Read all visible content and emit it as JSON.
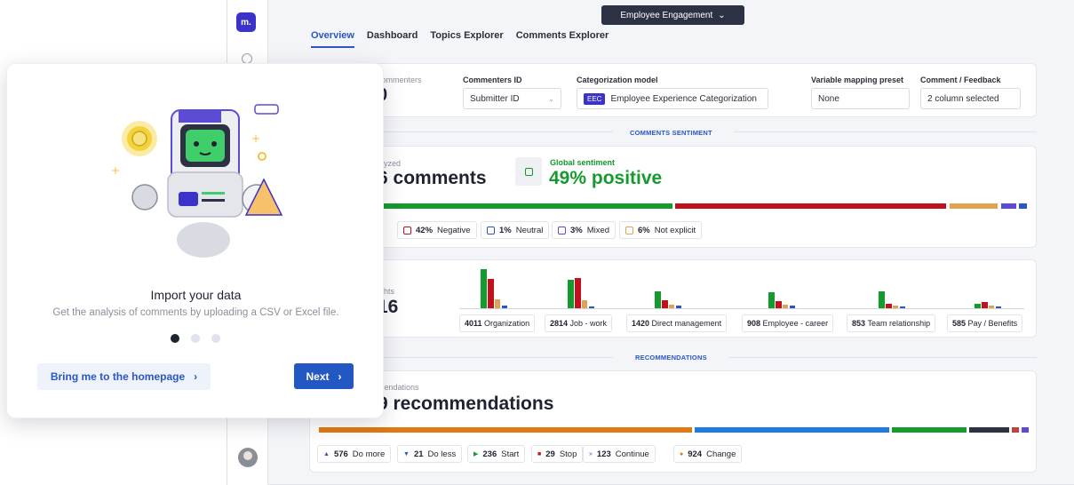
{
  "app": {
    "logo": "m.",
    "survey_selector": "Employee Engagement",
    "tabs": [
      "Overview",
      "Dashboard",
      "Topics Explorer",
      "Comments Explorer"
    ]
  },
  "config": {
    "commenters_label": "commenters",
    "commenters_value": "0",
    "commenters_id_label": "Commenters ID",
    "commenters_id_value": "Submitter ID",
    "categorization_label": "Categorization model",
    "categorization_badge": "EEC",
    "categorization_value": "Employee Experience Categorization",
    "variable_label": "Variable mapping preset",
    "variable_value": "None",
    "comment_label": "Comment / Feedback",
    "comment_value": "2 column selected"
  },
  "sentiment": {
    "section_title": "COMMENTS SENTIMENT",
    "analyzed_label": "alyzed",
    "analyzed_value": "6 comments",
    "global_label": "Global sentiment",
    "global_value": "49% positive",
    "colors": {
      "positive": "#159a2e",
      "negative": "#c2111c",
      "neutral": "#2a56c6",
      "mixed": "#5b4bd6",
      "not_explicit": "#e0a34f"
    },
    "chips": [
      {
        "value": "42%",
        "label": "Negative",
        "color": "#c2111c"
      },
      {
        "value": "1%",
        "label": "Neutral",
        "color": "#2a56c6"
      },
      {
        "value": "3%",
        "label": "Mixed",
        "color": "#5b4bd6"
      },
      {
        "value": "6%",
        "label": "Not explicit",
        "color": "#e0a34f"
      }
    ]
  },
  "insights": {
    "label": "ights",
    "value": "16",
    "categories": [
      {
        "count": "4011",
        "name": "Organization",
        "bars": [
          100,
          76,
          22,
          6
        ]
      },
      {
        "count": "2814",
        "name": "Job - work",
        "bars": [
          72,
          78,
          20,
          4
        ]
      },
      {
        "count": "1420",
        "name": "Direct management",
        "bars": [
          44,
          20,
          8,
          6
        ]
      },
      {
        "count": "908",
        "name": "Employee - career",
        "bars": [
          40,
          18,
          8,
          6
        ]
      },
      {
        "count": "853",
        "name": "Team relationship",
        "bars": [
          44,
          12,
          6,
          4
        ]
      },
      {
        "count": "585",
        "name": "Pay / Benefits",
        "bars": [
          12,
          16,
          6,
          2
        ]
      }
    ]
  },
  "recommendations": {
    "section_title": "RECOMMENDATIONS",
    "label": "mendations",
    "value": "9 recommendations",
    "chips": [
      {
        "value": "576",
        "label": "Do more",
        "color": "#2a56c6",
        "glyph": "▲"
      },
      {
        "value": "21",
        "label": "Do less",
        "color": "#2a56c6",
        "glyph": "▼"
      },
      {
        "value": "236",
        "label": "Start",
        "color": "#159a2e",
        "glyph": "▶"
      },
      {
        "value": "29",
        "label": "Stop",
        "color": "#c2111c",
        "glyph": "■"
      },
      {
        "value": "123",
        "label": "Continue",
        "color": "#2a56c6",
        "glyph": "»"
      },
      {
        "value": "924",
        "label": "Change",
        "color": "#e07a10",
        "glyph": "●"
      }
    ]
  },
  "onboarding": {
    "title": "Import your data",
    "subtitle": "Get the analysis of comments by uploading a CSV or Excel file.",
    "secondary_button": "Bring me to the homepage",
    "primary_button": "Next",
    "step": 1,
    "steps": 3
  }
}
